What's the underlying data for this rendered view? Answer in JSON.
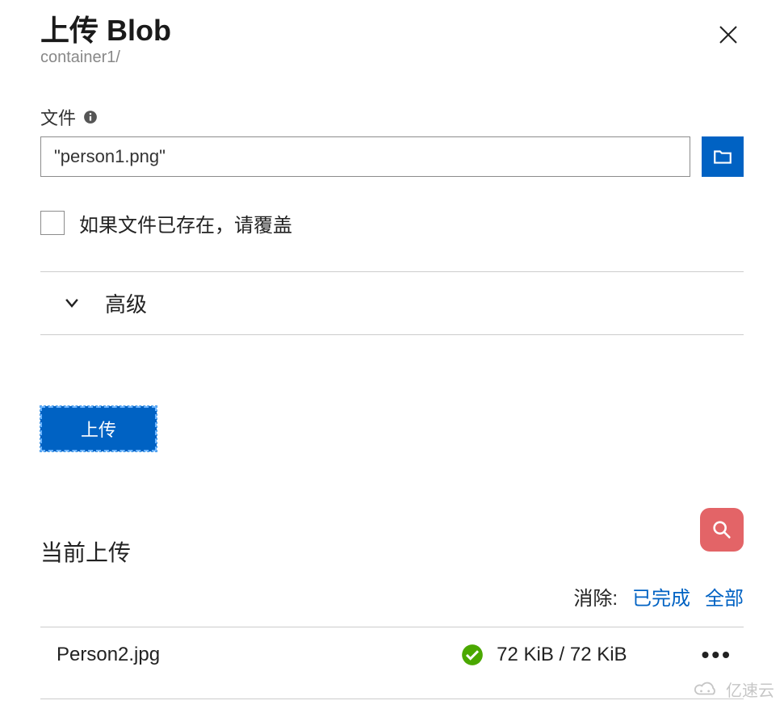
{
  "header": {
    "title": "上传 Blob",
    "breadcrumb": "container1/"
  },
  "file": {
    "label": "文件",
    "value": "\"person1.png\""
  },
  "overwrite": {
    "label": "如果文件已存在，请覆盖"
  },
  "advanced": {
    "label": "高级"
  },
  "actions": {
    "upload": "上传"
  },
  "current": {
    "title": "当前上传",
    "dismiss_label": "消除:",
    "dismiss_completed": "已完成",
    "dismiss_all": "全部",
    "items": [
      {
        "filename": "Person2.jpg",
        "size_text": "72 KiB / 72 KiB",
        "status": "success"
      }
    ]
  },
  "watermark": "亿速云"
}
